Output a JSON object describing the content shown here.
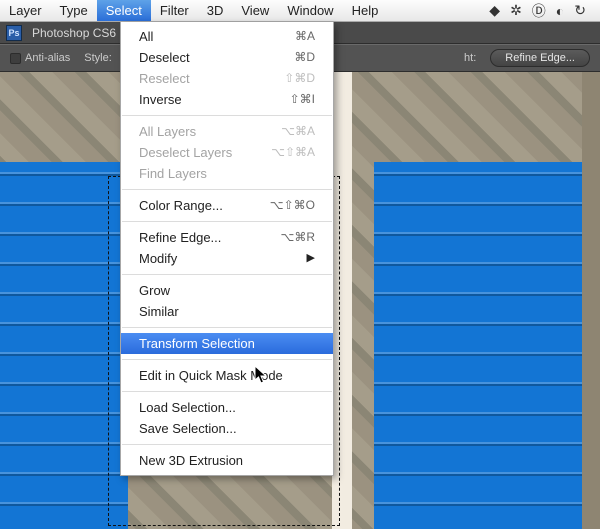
{
  "menubar": {
    "items": [
      {
        "label": "Layer"
      },
      {
        "label": "Type"
      },
      {
        "label": "Select"
      },
      {
        "label": "Filter"
      },
      {
        "label": "3D"
      },
      {
        "label": "View"
      },
      {
        "label": "Window"
      },
      {
        "label": "Help"
      }
    ],
    "active_index": 2,
    "tray": [
      "gdrive",
      "skitch",
      "develop",
      "creative-cloud",
      "sync"
    ]
  },
  "app": {
    "title": "Photoshop CS6"
  },
  "options_bar": {
    "anti_alias_label": "Anti-alias",
    "anti_alias_checked": false,
    "style_label": "Style:",
    "style_value": "",
    "width_or_ht_label": "ht:",
    "refine_edge_label": "Refine Edge..."
  },
  "dropdown": {
    "sections": [
      [
        {
          "label": "All",
          "shortcut": "⌘A",
          "enabled": true
        },
        {
          "label": "Deselect",
          "shortcut": "⌘D",
          "enabled": true
        },
        {
          "label": "Reselect",
          "shortcut": "⇧⌘D",
          "enabled": false
        },
        {
          "label": "Inverse",
          "shortcut": "⇧⌘I",
          "enabled": true
        }
      ],
      [
        {
          "label": "All Layers",
          "shortcut": "⌥⌘A",
          "enabled": false
        },
        {
          "label": "Deselect Layers",
          "shortcut": "⌥⇧⌘A",
          "enabled": false
        },
        {
          "label": "Find Layers",
          "enabled": false
        }
      ],
      [
        {
          "label": "Color Range...",
          "shortcut": "⌥⇧⌘O",
          "enabled": true
        }
      ],
      [
        {
          "label": "Refine Edge...",
          "shortcut": "⌥⌘R",
          "enabled": true
        },
        {
          "label": "Modify",
          "submenu": true,
          "enabled": true
        }
      ],
      [
        {
          "label": "Grow",
          "enabled": true
        },
        {
          "label": "Similar",
          "enabled": true
        }
      ],
      [
        {
          "label": "Transform Selection",
          "enabled": true,
          "highlighted": true
        }
      ],
      [
        {
          "label": "Edit in Quick Mask Mode",
          "enabled": true
        }
      ],
      [
        {
          "label": "Load Selection...",
          "enabled": true
        },
        {
          "label": "Save Selection...",
          "enabled": true
        }
      ],
      [
        {
          "label": "New 3D Extrusion",
          "enabled": true
        }
      ]
    ]
  }
}
